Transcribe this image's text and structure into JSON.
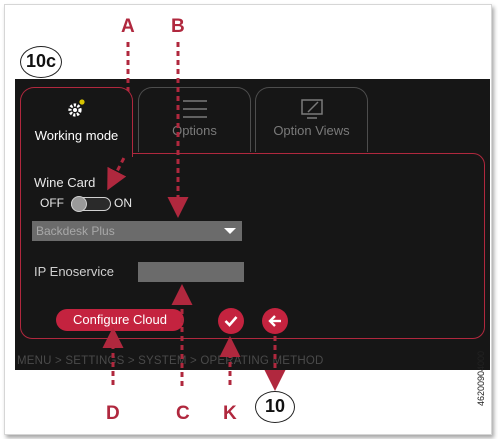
{
  "screen_badge": "10c",
  "tabs": [
    {
      "label": "Working mode",
      "icon": "gear-icon",
      "active": true
    },
    {
      "label": "Options",
      "icon": "list-icon",
      "active": false
    },
    {
      "label": "Option Views",
      "icon": "monitor-icon",
      "active": false
    }
  ],
  "form": {
    "wine_card_label": "Wine Card",
    "toggle_off": "OFF",
    "toggle_on": "ON",
    "toggle_state": "OFF",
    "select_value": "Backdesk Plus",
    "ip_label": "IP Enoservice",
    "ip_value": ""
  },
  "buttons": {
    "configure_cloud": "Configure Cloud",
    "confirm_icon": "checkmark-icon",
    "back_icon": "arrow-left-icon"
  },
  "breadcrumb": "MENU > SETTINGS > SYSTEM > OPERATING METHOD",
  "callouts": {
    "A": "A",
    "B": "B",
    "C": "C",
    "D": "D",
    "K": "K",
    "ten": "10"
  },
  "side_code": "46200904000",
  "colors": {
    "accent": "#c4233f",
    "screen_bg": "#161616",
    "callout": "#b0283e"
  }
}
